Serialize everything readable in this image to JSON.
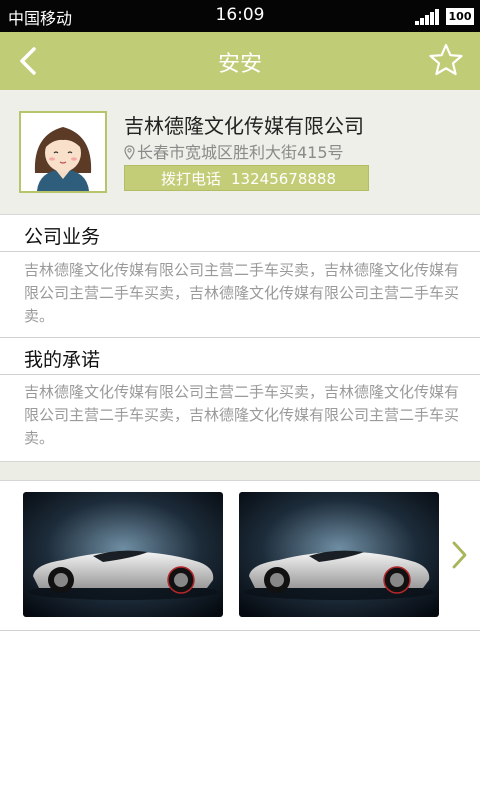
{
  "status_bar": {
    "carrier": "中国移动",
    "time": "16:09",
    "battery": "100"
  },
  "header": {
    "title": "安安",
    "back_icon": "chevron-left-icon",
    "favorite_icon": "star-outline-icon"
  },
  "profile": {
    "company_name": "吉林德隆文化传媒有限公司",
    "address": "长春市宽城区胜利大街415号",
    "call_label": "拨打电话",
    "phone": "13245678888"
  },
  "sections": {
    "business": {
      "title": "公司业务",
      "body": "吉林德隆文化传媒有限公司主营二手车买卖，吉林德隆文化传媒有限公司主营二手车买卖，吉林德隆文化传媒有限公司主营二手车买卖。"
    },
    "promise": {
      "title": "我的承诺",
      "body": "吉林德隆文化传媒有限公司主营二手车买卖，吉林德隆文化传媒有限公司主营二手车买卖，吉林德隆文化传媒有限公司主营二手车买卖。"
    }
  },
  "gallery": {
    "next_icon": "chevron-right-icon"
  },
  "colors": {
    "accent": "#c0cc76",
    "profile_bg": "#eeefe8",
    "body_text": "#9a9a9a"
  }
}
